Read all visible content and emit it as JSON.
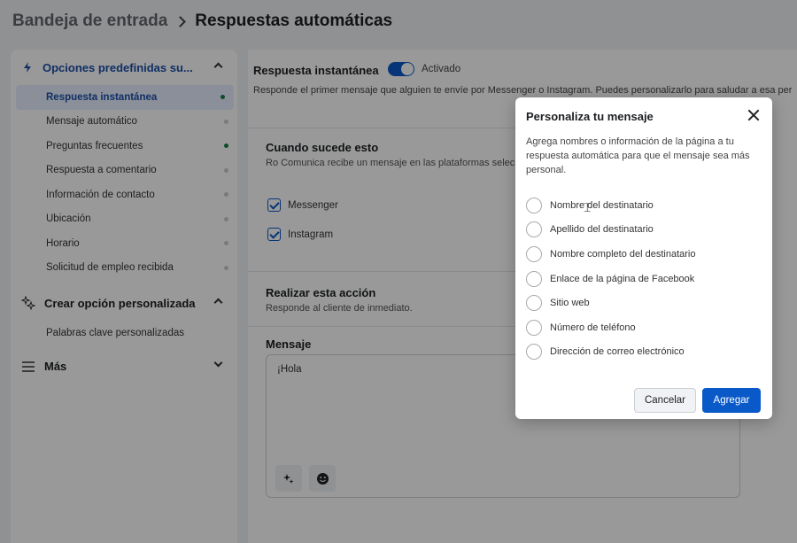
{
  "header": {
    "breadcrumb_parent": "Bandeja de entrada",
    "breadcrumb_current": "Respuestas automáticas"
  },
  "sidebar": {
    "section1_title": "Opciones predefinidas su...",
    "items": [
      {
        "label": "Respuesta instantánea",
        "status": "on"
      },
      {
        "label": "Mensaje automático",
        "status": "off"
      },
      {
        "label": "Preguntas frecuentes",
        "status": "on"
      },
      {
        "label": "Respuesta a comentario",
        "status": "off"
      },
      {
        "label": "Información de contacto",
        "status": "off"
      },
      {
        "label": "Ubicación",
        "status": "off"
      },
      {
        "label": "Horario",
        "status": "off"
      },
      {
        "label": "Solicitud de empleo recibida",
        "status": "off"
      }
    ],
    "section2_title": "Crear opción personalizada",
    "section2_items": [
      "Palabras clave personalizadas"
    ],
    "section3_title": "Más"
  },
  "main": {
    "title": "Respuesta instantánea",
    "toggle_label": "Activado",
    "description": "Responde el primer mensaje que alguien te envíe por Messenger o Instagram. Puedes personalizarlo para saludar a esa per",
    "trigger": {
      "title": "Cuando sucede esto",
      "subtitle": "Ro Comunica recibe un mensaje en las plataformas selec",
      "platforms": [
        "Messenger",
        "Instagram"
      ]
    },
    "action": {
      "title": "Realizar esta acción",
      "subtitle": "Responde al cliente de inmediato."
    },
    "message": {
      "title": "Mensaje",
      "value": "¡Hola"
    }
  },
  "modal": {
    "title": "Personaliza tu mensaje",
    "description": "Agrega nombres o información de la página a tu respuesta automática para que el mensaje sea más personal.",
    "options": [
      "Nombre del destinatario",
      "Apellido del destinatario",
      "Nombre completo del destinatario",
      "Enlace de la página de Facebook",
      "Sitio web",
      "Número de teléfono",
      "Dirección de correo electrónico"
    ],
    "cancel_label": "Cancelar",
    "add_label": "Agregar"
  },
  "colors": {
    "accent": "#0a59c9",
    "active_dot": "#1a7f45",
    "active_item_bg": "#e6efff"
  }
}
